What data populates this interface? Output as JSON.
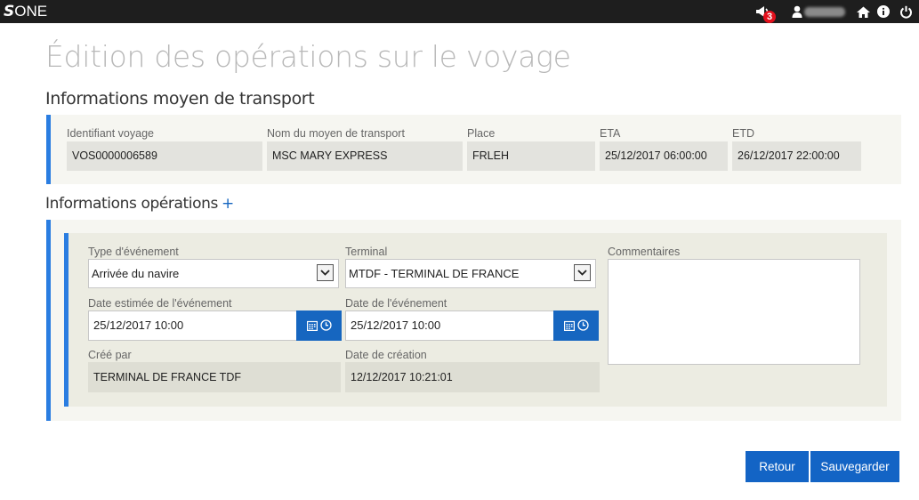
{
  "topbar": {
    "logo_mark": "S",
    "logo_text": "ONE",
    "notification_count": "3",
    "icons": [
      "megaphone-icon",
      "user-icon",
      "home-icon",
      "info-icon",
      "power-icon"
    ]
  },
  "page": {
    "title": "Édition des opérations sur le voyage"
  },
  "transport": {
    "section_title": "Informations moyen de transport",
    "fields": {
      "voyage_id": {
        "label": "Identifiant voyage",
        "value": "VOS0000006589"
      },
      "transport_name": {
        "label": "Nom du moyen de transport",
        "value": "MSC MARY EXPRESS"
      },
      "place": {
        "label": "Place",
        "value": "FRLEH"
      },
      "eta": {
        "label": "ETA",
        "value": "25/12/2017 06:00:00"
      },
      "etd": {
        "label": "ETD",
        "value": "26/12/2017 22:00:00"
      }
    }
  },
  "operations": {
    "section_title": "Informations opérations",
    "add_symbol": "+",
    "event_type": {
      "label": "Type d'événement",
      "value": "Arrivée du navire"
    },
    "terminal": {
      "label": "Terminal",
      "value": "MTDF - TERMINAL DE FRANCE"
    },
    "comments": {
      "label": "Commentaires",
      "value": ""
    },
    "estimated_date": {
      "label": "Date estimée de l'événement",
      "value": "25/12/2017 10:00"
    },
    "event_date": {
      "label": "Date de l'événement",
      "value": "25/12/2017 10:00"
    },
    "created_by": {
      "label": "Créé par",
      "value": "TERMINAL DE FRANCE TDF"
    },
    "creation_date": {
      "label": "Date de création",
      "value": "12/12/2017 10:21:01"
    }
  },
  "actions": {
    "back_label": "Retour",
    "save_label": "Sauvegarder"
  },
  "colors": {
    "accent": "#2a7de1",
    "button": "#1364c5",
    "topbar": "#1e1e1e",
    "badge": "#e3101c"
  }
}
